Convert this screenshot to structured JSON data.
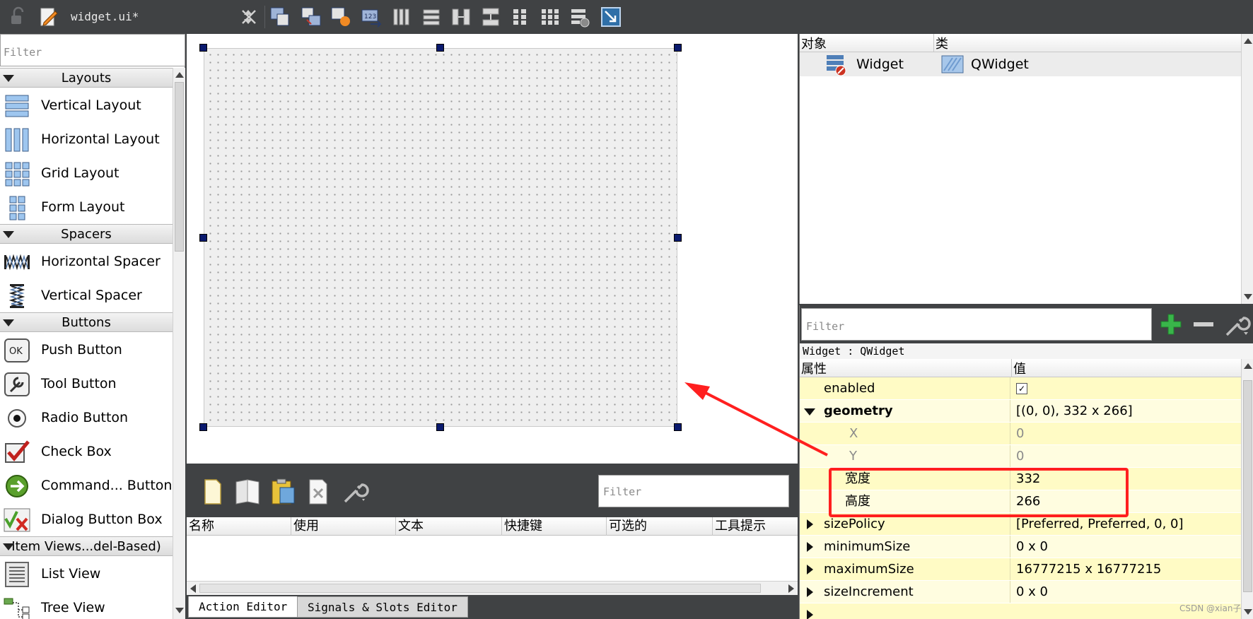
{
  "toolbar": {
    "file_name": "widget.ui*"
  },
  "widget_box": {
    "filter_placeholder": "Filter",
    "categories": [
      {
        "label": "Layouts"
      },
      {
        "label": "Spacers"
      },
      {
        "label": "Buttons"
      },
      {
        "label": "Item Views...del-Based)"
      }
    ],
    "items": [
      {
        "label": "Vertical Layout",
        "icon": "vertical-layout-icon"
      },
      {
        "label": "Horizontal Layout",
        "icon": "horizontal-layout-icon"
      },
      {
        "label": "Grid Layout",
        "icon": "grid-layout-icon"
      },
      {
        "label": "Form Layout",
        "icon": "form-layout-icon"
      },
      {
        "label": "Horizontal Spacer",
        "icon": "horizontal-spacer-icon"
      },
      {
        "label": "Vertical Spacer",
        "icon": "vertical-spacer-icon"
      },
      {
        "label": "Push Button",
        "icon": "push-button-icon"
      },
      {
        "label": "Tool Button",
        "icon": "tool-button-icon"
      },
      {
        "label": "Radio Button",
        "icon": "radio-button-icon"
      },
      {
        "label": "Check Box",
        "icon": "check-box-icon"
      },
      {
        "label": "Command... Button",
        "icon": "command-link-button-icon"
      },
      {
        "label": "Dialog Button Box",
        "icon": "dialog-button-box-icon"
      },
      {
        "label": "List View",
        "icon": "list-view-icon"
      },
      {
        "label": "Tree View",
        "icon": "tree-view-icon"
      }
    ],
    "push_button_icon_text": "OK"
  },
  "action_editor": {
    "filter_placeholder": "Filter",
    "columns": [
      "名称",
      "使用",
      "文本",
      "快捷键",
      "可选的",
      "工具提示"
    ],
    "tabs": [
      {
        "label": "Action Editor"
      },
      {
        "label": "Signals & Slots Editor"
      }
    ]
  },
  "object_inspector": {
    "columns": [
      "对象",
      "类"
    ],
    "rows": [
      {
        "object": "Widget",
        "class": "QWidget"
      }
    ]
  },
  "property_editor": {
    "filter_placeholder": "Filter",
    "context_label": "Widget : QWidget",
    "columns": [
      "属性",
      "值"
    ],
    "rows": [
      {
        "name": "enabled",
        "value": "✓"
      },
      {
        "name": "geometry",
        "value": "[(0, 0), 332 x 266]"
      },
      {
        "name": "X",
        "value": "0"
      },
      {
        "name": "Y",
        "value": "0"
      },
      {
        "name": "宽度",
        "value": "332"
      },
      {
        "name": "高度",
        "value": "266"
      },
      {
        "name": "sizePolicy",
        "value": "[Preferred, Preferred, 0, 0]"
      },
      {
        "name": "minimumSize",
        "value": "0 x 0"
      },
      {
        "name": "maximumSize",
        "value": "16777215 x 16777215"
      },
      {
        "name": "sizeIncrement",
        "value": "0 x 0"
      }
    ]
  },
  "watermark": "CSDN @xian子",
  "colors": {
    "dark_chrome": "#404244",
    "property_row": "#fffbc5",
    "annotation_red": "#ff1f1f",
    "handle": "#0a1a6e"
  }
}
